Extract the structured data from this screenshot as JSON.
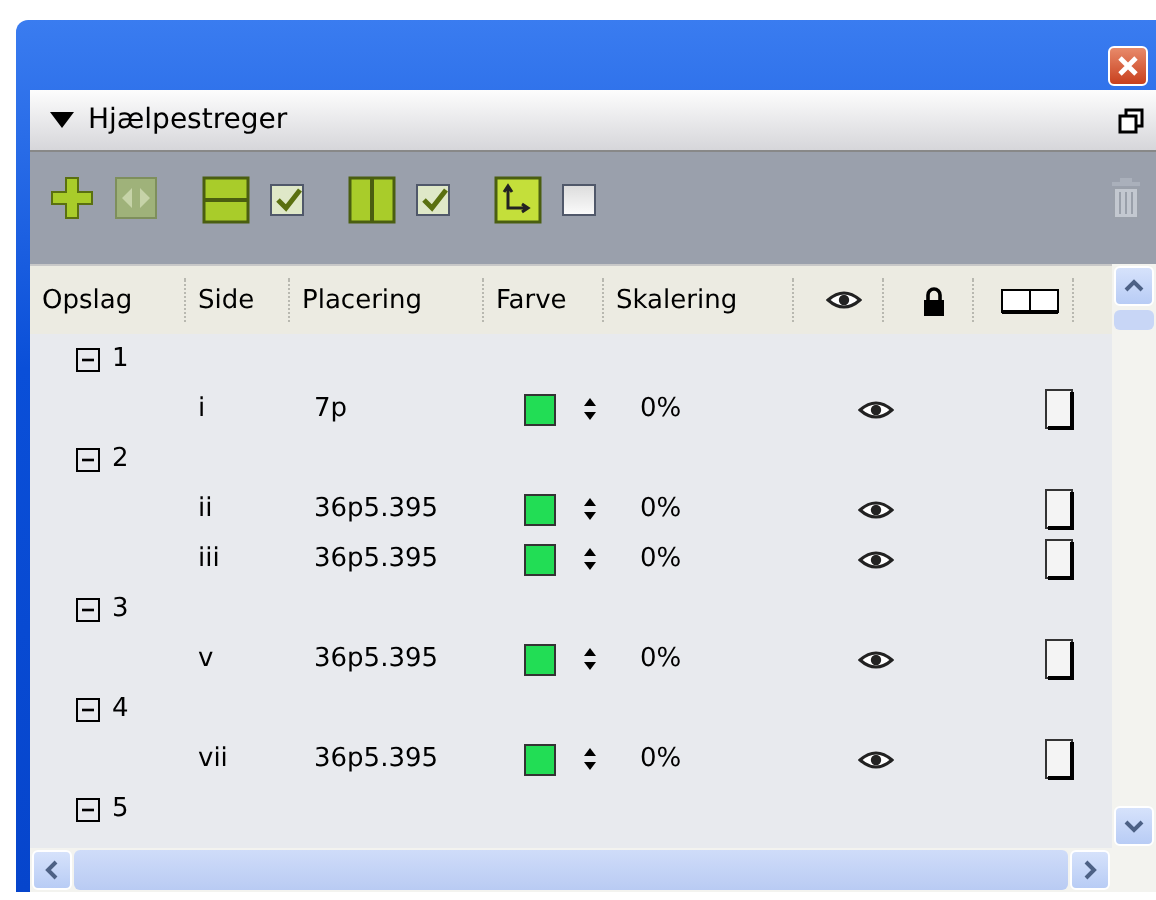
{
  "panel": {
    "title": "Hjælpestreger",
    "expanded": true
  },
  "toolbar": {
    "toggles": [
      {
        "kind": "horizontal",
        "checked": true
      },
      {
        "kind": "vertical",
        "checked": true
      },
      {
        "kind": "rotate",
        "checked": false
      }
    ]
  },
  "table": {
    "columns": [
      "Opslag",
      "Side",
      "Placering",
      "Farve",
      "Skalering"
    ],
    "rows": [
      {
        "label": "1",
        "expanded": true,
        "children": [
          {
            "side": "i",
            "placement": "7p",
            "color": "#22dd55",
            "scale": "0%",
            "visible": true
          }
        ]
      },
      {
        "label": "2",
        "expanded": true,
        "children": [
          {
            "side": "ii",
            "placement": "36p5.395",
            "color": "#22dd55",
            "scale": "0%",
            "visible": true
          },
          {
            "side": "iii",
            "placement": "36p5.395",
            "color": "#22dd55",
            "scale": "0%",
            "visible": true
          }
        ]
      },
      {
        "label": "3",
        "expanded": true,
        "children": [
          {
            "side": "v",
            "placement": "36p5.395",
            "color": "#22dd55",
            "scale": "0%",
            "visible": true
          }
        ]
      },
      {
        "label": "4",
        "expanded": true,
        "children": [
          {
            "side": "vii",
            "placement": "36p5.395",
            "color": "#22dd55",
            "scale": "0%",
            "visible": true
          }
        ]
      },
      {
        "label": "5",
        "expanded": true,
        "children": []
      }
    ]
  }
}
